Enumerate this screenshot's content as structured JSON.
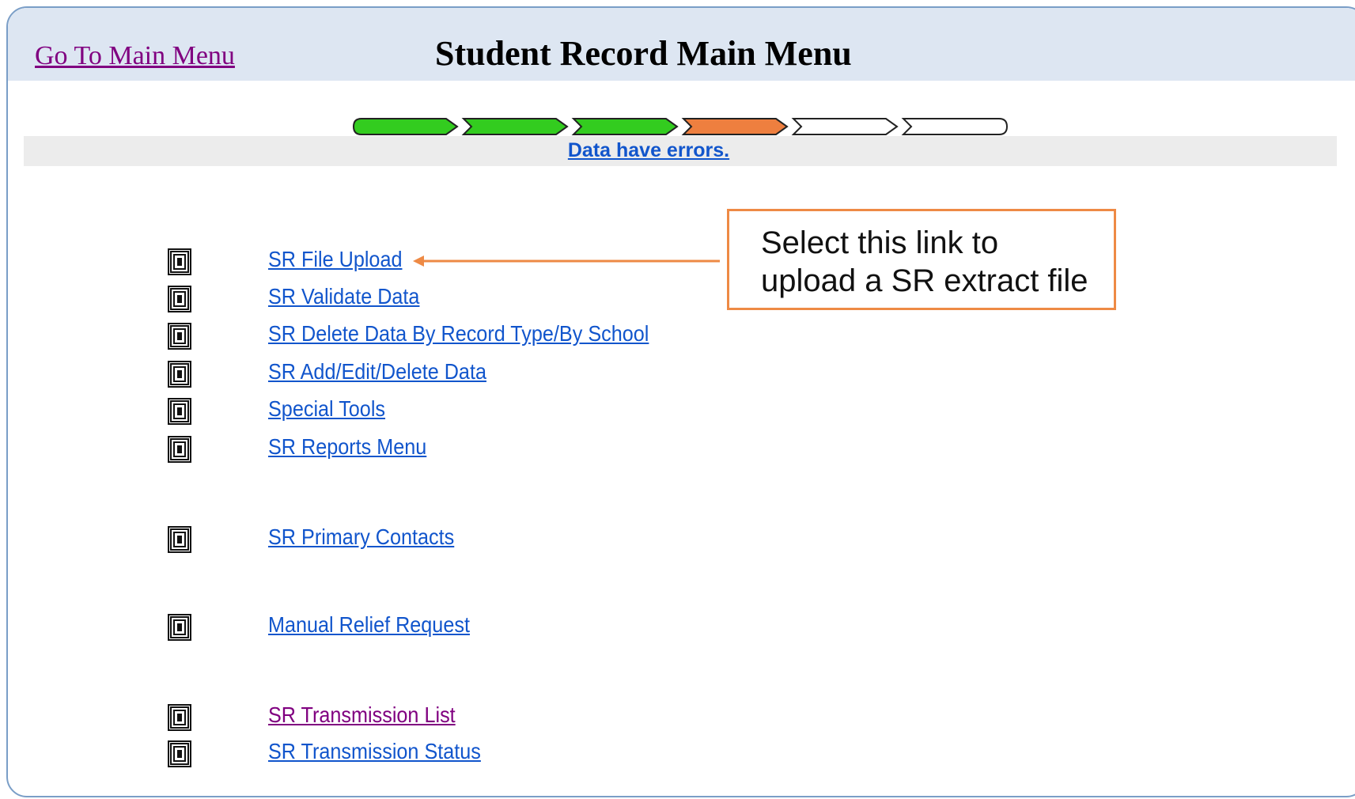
{
  "header": {
    "nav_link": "Go To Main Menu",
    "title": "Student Record Main Menu"
  },
  "progress": {
    "steps": [
      {
        "state": "complete",
        "color": "#33cc1f"
      },
      {
        "state": "complete",
        "color": "#33cc1f"
      },
      {
        "state": "complete",
        "color": "#33cc1f"
      },
      {
        "state": "current-error",
        "color": "#ee7f3f"
      },
      {
        "state": "pending",
        "color": "#ffffff"
      },
      {
        "state": "pending",
        "color": "#ffffff"
      }
    ],
    "status_text": "Data have errors."
  },
  "menu": {
    "items": [
      {
        "label": "SR File Upload",
        "icon": "menu-item-icon",
        "visited": false
      },
      {
        "label": "SR Validate Data",
        "icon": "menu-item-icon",
        "visited": false
      },
      {
        "label": "SR Delete Data By Record Type/By School",
        "icon": "menu-item-icon",
        "visited": false
      },
      {
        "label": "SR Add/Edit/Delete Data",
        "icon": "menu-item-icon",
        "visited": false
      },
      {
        "label": "Special Tools",
        "icon": "menu-item-icon",
        "visited": false
      },
      {
        "label": "SR Reports Menu",
        "icon": "menu-item-icon",
        "visited": false
      },
      {
        "label": "SR Primary Contacts",
        "icon": "menu-item-icon",
        "visited": false
      },
      {
        "label": "Manual Relief Request",
        "icon": "menu-item-icon",
        "visited": false
      },
      {
        "label": "SR Transmission List",
        "icon": "menu-item-icon",
        "visited": true
      },
      {
        "label": "SR Transmission Status",
        "icon": "menu-item-icon",
        "visited": false
      }
    ]
  },
  "callout": {
    "text": "Select this link to\nupload a SR extract file"
  },
  "colors": {
    "header_bg": "#dde6f2",
    "link": "#1155cc",
    "visited_link": "#800080",
    "accent_orange": "#ee8a45"
  }
}
